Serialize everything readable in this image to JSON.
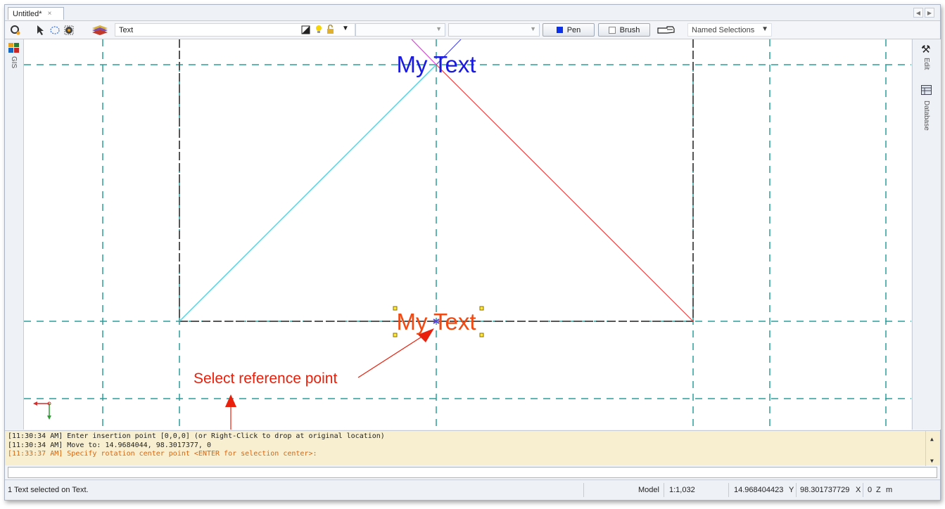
{
  "tab": {
    "title": "Untitled*",
    "close": "×"
  },
  "nav": {
    "left": "◀",
    "right": "▶"
  },
  "toolbar": {
    "layer_name": "Text",
    "pen_label": "Pen",
    "brush_label": "Brush",
    "named_selections": "Named Selections",
    "pen_color": "#0a2fe6"
  },
  "left_panel": {
    "gis_label": "GIS"
  },
  "right_panel": {
    "edit_label": "Edit",
    "database_label": "Database"
  },
  "canvas": {
    "top_text": "My Text",
    "bottom_text": "My Text",
    "top_text_color": "#1a1adf",
    "bottom_text_color": "#f04a14"
  },
  "annotation": {
    "label": "Select reference point"
  },
  "command_log": [
    {
      "text": "[11:30:34 AM] Enter insertion point [0,0,0] (or Right-Click to drop at original location)",
      "style": "normal"
    },
    {
      "text": "[11:30:34 AM] Move to: 14.9684044, 98.3017377, 0",
      "style": "normal"
    },
    {
      "text": "[11:33:37 AM] Specify rotation center point <ENTER for selection center>:",
      "style": "orange"
    }
  ],
  "status": {
    "message": "1 Text selected on Text.",
    "model": "Model",
    "scale": "1:1,032",
    "y_value": "14.968404423",
    "y_label": "Y",
    "x_value": "98.301737729",
    "x_label": "X",
    "z_value": "0",
    "z_label": "Z",
    "unit": "m"
  }
}
